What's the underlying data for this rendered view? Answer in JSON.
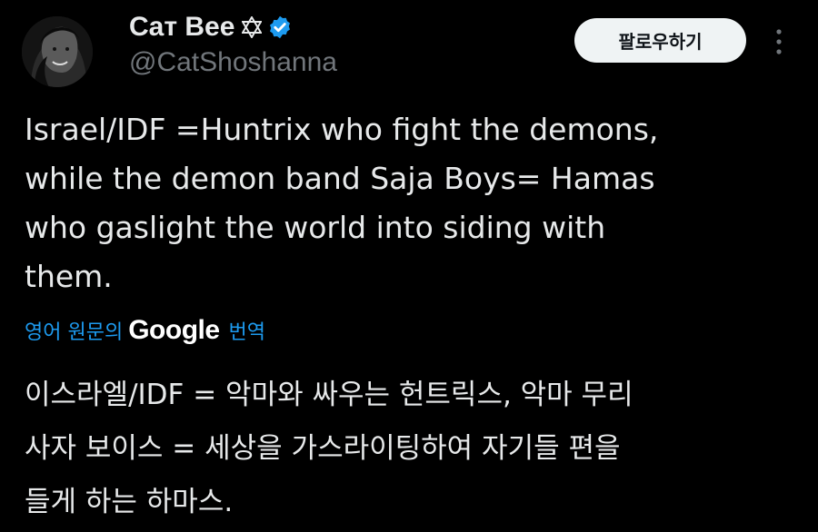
{
  "author": {
    "display_name": "Caт Bee",
    "handle": "@CatShoshanna",
    "star_icon": "star-of-david-icon",
    "verified_icon": "verified-badge-icon",
    "verified_color": "#1d9bf0"
  },
  "follow_button": {
    "label": "팔로우하기"
  },
  "more_menu": {
    "icon": "more-vertical-icon"
  },
  "tweet": {
    "lines": [
      "Israel/IDF =Huntrix who fight the demons,",
      "while the demon band Saja Boys= Hamas",
      "who gaslight the world into siding with",
      "them."
    ]
  },
  "translation": {
    "prefix": "영어 원문의",
    "provider": "Google",
    "suffix": "번역",
    "lines": [
      "이스라엘/IDF = 악마와 싸우는 헌트릭스, 악마 무리",
      "사자 보이스 = 세상을 가스라이팅하여 자기들 편을",
      "들게 하는 하마스."
    ]
  },
  "colors": {
    "background": "#000000",
    "text": "#e7e9ea",
    "secondary_text": "#71767b",
    "accent": "#1d9bf0"
  }
}
